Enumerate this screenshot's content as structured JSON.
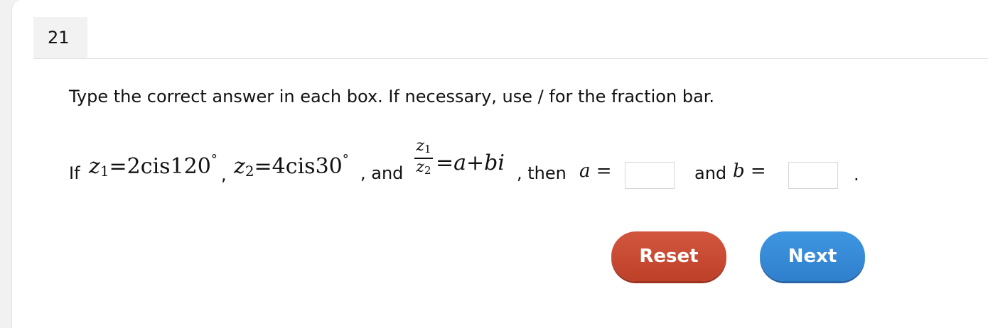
{
  "question": {
    "number": "21",
    "instruction": "Type the correct answer in each box. If necessary, use / for the fraction bar."
  },
  "equation": {
    "if_label": "If",
    "z1_var": "z",
    "z1_sub": "1",
    "z1_eq": "=2cis120",
    "degree": "°",
    "comma1": ",",
    "z2_var": "z",
    "z2_sub": "2",
    "z2_eq": "=4cis30",
    "comma_and": ", and",
    "frac_num_var": "z",
    "frac_num_sub": "1",
    "frac_den_var": "z",
    "frac_den_sub": "2",
    "rhs_eq": "=",
    "rhs_a": "a",
    "rhs_plus": "+",
    "rhs_bi": "bi",
    "then_label": ", then",
    "a_var": "a",
    "a_eq": " =",
    "and_label": "and",
    "b_var": "b",
    "b_eq": " =",
    "period": "."
  },
  "answers": {
    "a_value": "",
    "b_value": ""
  },
  "buttons": {
    "reset": "Reset",
    "next": "Next"
  }
}
